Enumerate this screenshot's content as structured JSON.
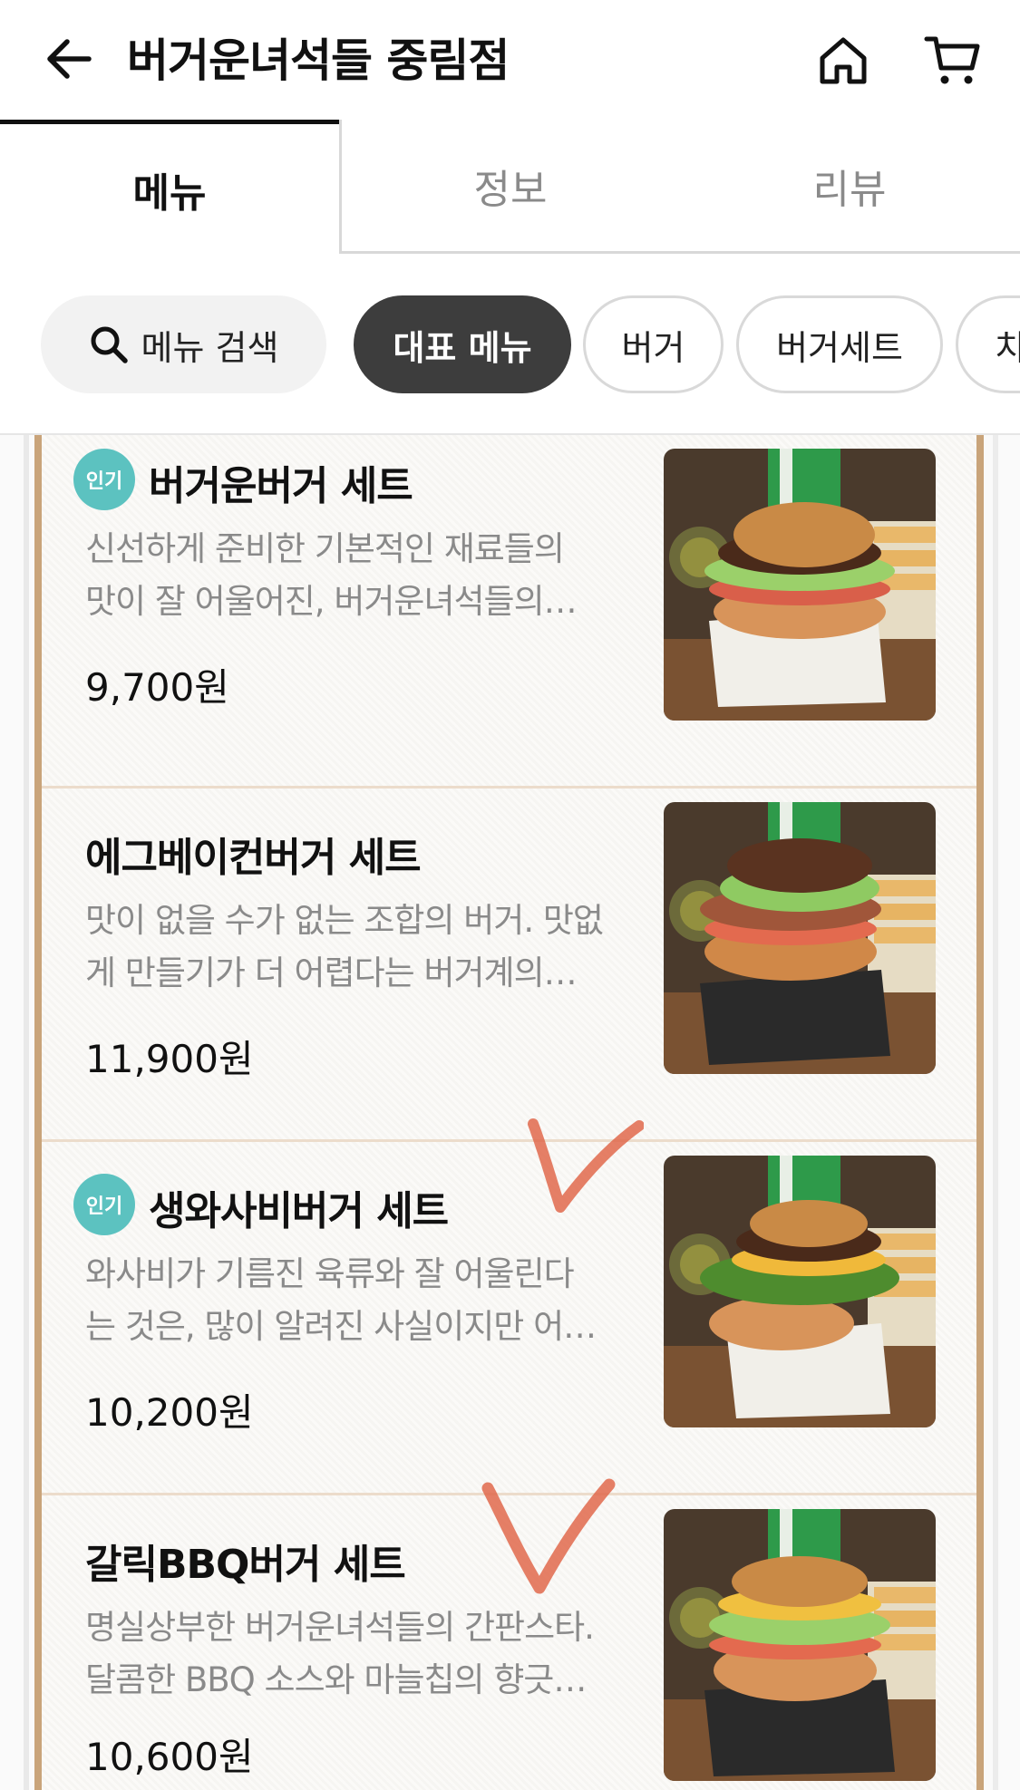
{
  "header": {
    "title": "버거운녀석들 중림점"
  },
  "tabs": [
    {
      "label": "메뉴"
    },
    {
      "label": "정보"
    },
    {
      "label": "리뷰"
    }
  ],
  "chips": {
    "search": "메뉴 검색",
    "active": "대표 메뉴",
    "burger": "버거",
    "set": "버거세트",
    "partial": "치"
  },
  "items": [
    {
      "badge": "인기",
      "name": "버거운버거 세트",
      "desc_line1": "신선하게 준비한 기본적인 재료들의",
      "desc_line2": "맛이 잘 어울어진, 버거운녀석들의…",
      "price": "9,700원"
    },
    {
      "badge": "",
      "name": "에그베이컨버거 세트",
      "desc_line1": "맛이 없을 수가 없는 조합의 버거. 맛없",
      "desc_line2": "게 만들기가 더 어렵다는 버거계의…",
      "price": "11,900원"
    },
    {
      "badge": "인기",
      "name": "생와사비버거 세트",
      "desc_line1": "와사비가 기름진 육류와 잘 어울린다",
      "desc_line2": "는 것은, 많이 알려진 사실이지만 어…",
      "price": "10,200원"
    },
    {
      "badge": "",
      "name": "갈릭BBQ버거 세트",
      "desc_line1": "명실상부한 버거운녀석들의 간판스타.",
      "desc_line2": "달콤한 BBQ 소스와 마늘칩의 향긋…",
      "price": "10,600원"
    }
  ],
  "colors": {
    "accent_badge": "#5cc2c0",
    "active_chip": "#3d3d3d",
    "wood_border": "#c9a47a",
    "check_mark": "#e0684c"
  }
}
